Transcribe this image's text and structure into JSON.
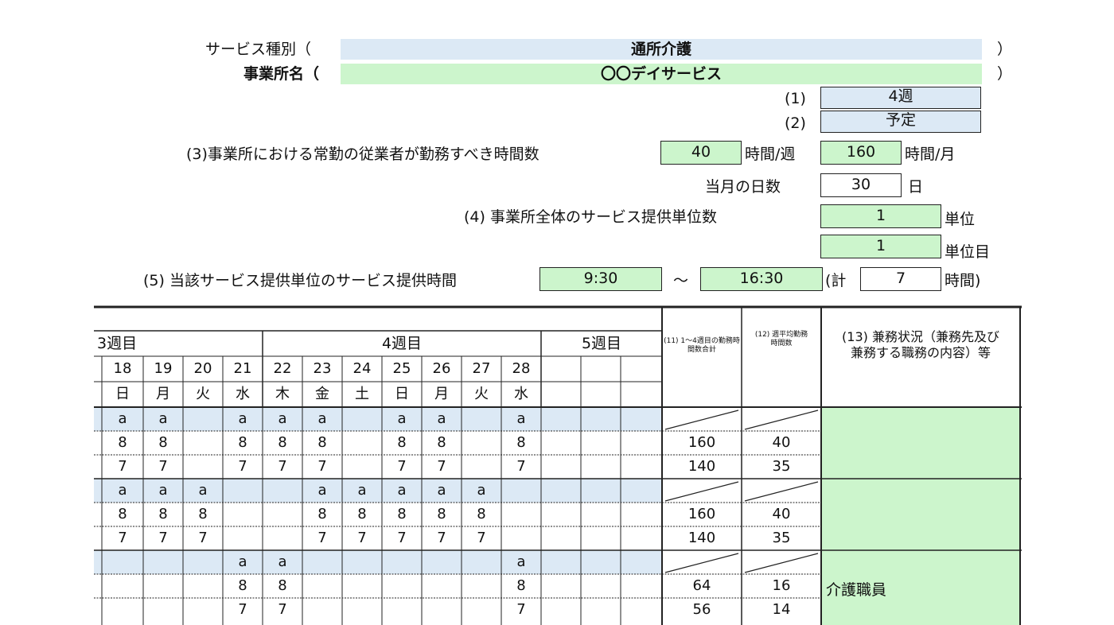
{
  "header": {
    "service_type_label": "サービス種別（",
    "service_type_value": "通所介護",
    "office_name_label": "事業所名（",
    "office_name_value": "〇〇デイサービス",
    "close_paren": "）",
    "item1_label": "(1)",
    "item1_value": "4週",
    "item2_label": "(2)",
    "item2_value": "予定",
    "item3_label": "(3)事業所における常勤の従業者が勤務すべき時間数",
    "item3_week_value": "40",
    "item3_week_unit": "時間/週",
    "item3_month_value": "160",
    "item3_month_unit": "時間/月",
    "days_label": "当月の日数",
    "days_value": "30",
    "days_unit": "日",
    "item4_label": "(4) 事業所全体のサービス提供単位数",
    "item4_value": "1",
    "item4_unit": "単位",
    "item4b_value": "1",
    "item4b_unit": "単位目",
    "item5_label": "(5) 当該サービス提供単位のサービス提供時間",
    "item5_start": "9:30",
    "item5_tilde": "～",
    "item5_end": "16:30",
    "item5_total_open": "(計",
    "item5_total_value": "7",
    "item5_total_unit": "時間)"
  },
  "table": {
    "week3_label": "3週目",
    "week4_label": "4週目",
    "week5_label": "5週目",
    "col11_label": "(11) 1～4週目の勤務時間数合計",
    "col12_label": "(12) 週平均勤務時間数",
    "col13_label": "(13) 兼務状況（兼務先及び兼務する職務の内容）等",
    "dates": [
      "18",
      "19",
      "20",
      "21",
      "22",
      "23",
      "24",
      "25",
      "26",
      "27",
      "28"
    ],
    "weekdays": [
      "日",
      "月",
      "火",
      "水",
      "木",
      "金",
      "土",
      "日",
      "月",
      "火",
      "水"
    ],
    "rows": [
      {
        "shift": [
          "a",
          "a",
          "",
          "a",
          "a",
          "a",
          "",
          "a",
          "a",
          "",
          "a"
        ],
        "hours_a": [
          "8",
          "8",
          "",
          "8",
          "8",
          "8",
          "",
          "8",
          "8",
          "",
          "8"
        ],
        "hours_b": [
          "7",
          "7",
          "",
          "7",
          "7",
          "7",
          "",
          "7",
          "7",
          "",
          "7"
        ],
        "total_a": "160",
        "avg_a": "40",
        "total_b": "140",
        "avg_b": "35",
        "note": ""
      },
      {
        "shift": [
          "a",
          "a",
          "a",
          "",
          "",
          "a",
          "a",
          "a",
          "a",
          "a",
          ""
        ],
        "hours_a": [
          "8",
          "8",
          "8",
          "",
          "",
          "8",
          "8",
          "8",
          "8",
          "8",
          ""
        ],
        "hours_b": [
          "7",
          "7",
          "7",
          "",
          "",
          "7",
          "7",
          "7",
          "7",
          "7",
          ""
        ],
        "total_a": "160",
        "avg_a": "40",
        "total_b": "140",
        "avg_b": "35",
        "note": ""
      },
      {
        "shift": [
          "",
          "",
          "",
          "a",
          "a",
          "",
          "",
          "",
          "",
          "",
          "a"
        ],
        "hours_a": [
          "",
          "",
          "",
          "8",
          "8",
          "",
          "",
          "",
          "",
          "",
          "8"
        ],
        "hours_b": [
          "",
          "",
          "",
          "7",
          "7",
          "",
          "",
          "",
          "",
          "",
          "7"
        ],
        "total_a": "64",
        "avg_a": "16",
        "total_b": "56",
        "avg_b": "14",
        "note": "介護職員"
      }
    ]
  },
  "colors": {
    "green": "#ccf5cc",
    "blue": "#dce9f5"
  }
}
